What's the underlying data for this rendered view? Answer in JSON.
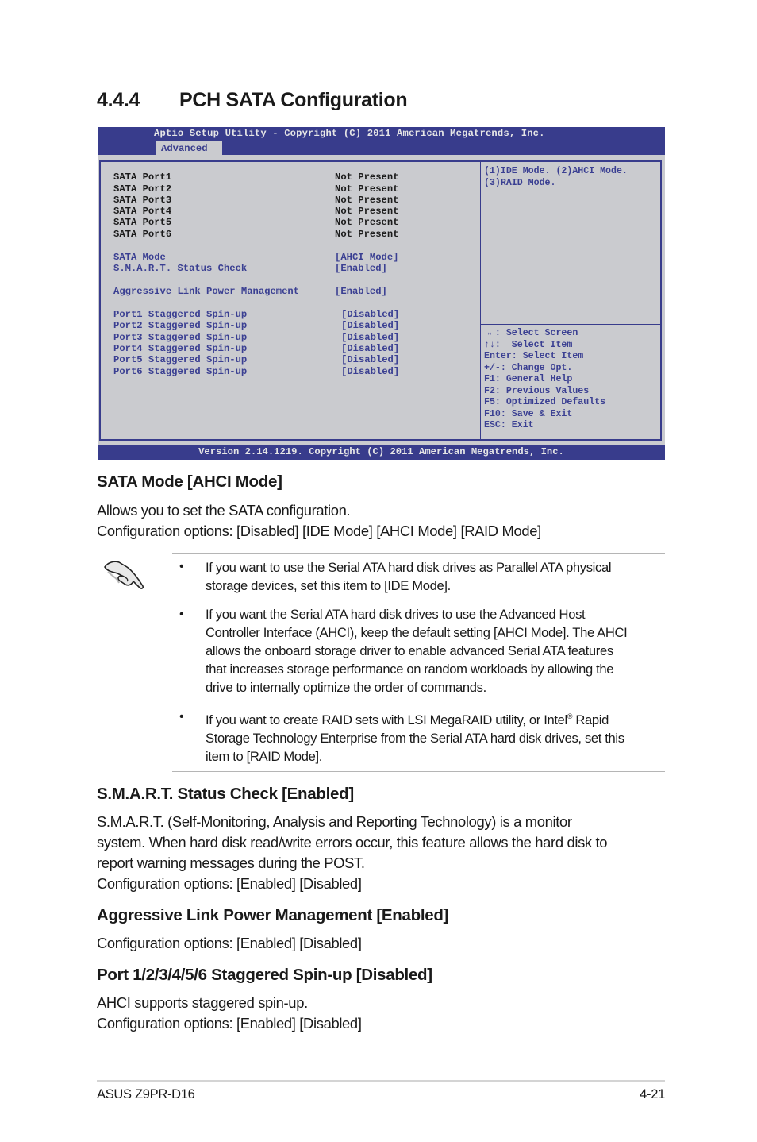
{
  "section": {
    "number": "4.4.4",
    "title": "PCH SATA Configuration"
  },
  "bios": {
    "header_title": "Aptio Setup Utility - Copyright (C) 2011 American Megatrends, Inc.",
    "active_tab": "Advanced",
    "ports": [
      {
        "label": "SATA Port1",
        "value": "Not Present"
      },
      {
        "label": "SATA Port2",
        "value": "Not Present"
      },
      {
        "label": "SATA Port3",
        "value": "Not Present"
      },
      {
        "label": "SATA Port4",
        "value": "Not Present"
      },
      {
        "label": "SATA Port5",
        "value": "Not Present"
      },
      {
        "label": "SATA Port6",
        "value": "Not Present"
      }
    ],
    "settings": [
      {
        "label": "SATA Mode",
        "value": "[AHCI Mode]"
      },
      {
        "label": "S.M.A.R.T. Status Check",
        "value": "[Enabled]"
      }
    ],
    "alpm": {
      "label": "Aggressive Link Power Management",
      "value": "[Enabled]"
    },
    "staggered": [
      {
        "label": "Port1 Staggered Spin-up",
        "value": "[Disabled]"
      },
      {
        "label": "Port2 Staggered Spin-up",
        "value": "[Disabled]"
      },
      {
        "label": "Port3 Staggered Spin-up",
        "value": "[Disabled]"
      },
      {
        "label": "Port4 Staggered Spin-up",
        "value": "[Disabled]"
      },
      {
        "label": "Port5 Staggered Spin-up",
        "value": "[Disabled]"
      },
      {
        "label": "Port6 Staggered Spin-up",
        "value": "[Disabled]"
      }
    ],
    "help_text": [
      "(1)IDE Mode. (2)AHCI Mode.",
      "(3)RAID Mode."
    ],
    "key_legend": [
      "→←: Select Screen",
      "↑↓:  Select Item",
      "Enter: Select Item",
      "+/-: Change Opt.",
      "F1: General Help",
      "F2: Previous Values",
      "F5: Optimized Defaults",
      "F10: Save & Exit",
      "ESC: Exit"
    ],
    "footer": "Version 2.14.1219. Copyright (C) 2011 American Megatrends, Inc.",
    "colors": {
      "bar": "#383c8c",
      "body": "#cacbcf",
      "selectable_text": "#3a3f92"
    }
  },
  "sata_mode": {
    "heading": "SATA Mode [AHCI Mode]",
    "lines": [
      "Allows you to set the SATA configuration.",
      "Configuration options: [Disabled] [IDE Mode] [AHCI Mode] [RAID Mode]"
    ]
  },
  "note": {
    "icon": "pointing-hand-icon",
    "bullets": [
      [
        "If you want to use the Serial ATA hard disk drives as Parallel ATA physical",
        "storage devices, set this item to [IDE Mode]."
      ],
      [
        "If you want the Serial ATA hard disk drives to use the Advanced Host",
        "Controller Interface (AHCI), keep the default setting [AHCI Mode]. The AHCI",
        "allows the onboard storage driver to enable advanced Serial ATA features",
        "that increases storage performance on random workloads by allowing the",
        "drive to internally optimize the order of commands."
      ],
      [
        "If you want to create RAID sets with LSI MegaRAID utility, or Intel",
        "Storage Technology Enterprise from the Serial ATA hard disk drives, set this",
        "item to [RAID Mode]."
      ]
    ],
    "bullet3_line1_suffix": " Rapid",
    "registered_mark": "®",
    "bullet_char": "•"
  },
  "smart": {
    "heading": "S.M.A.R.T. Status Check [Enabled]",
    "lines": [
      "S.M.A.R.T. (Self-Monitoring, Analysis and Reporting Technology) is a monitor",
      "system. When hard disk read/write errors occur, this feature allows the hard disk to",
      "report warning messages during the POST.",
      "Configuration options: [Enabled] [Disabled]"
    ]
  },
  "alpm_doc": {
    "heading": "Aggressive Link Power Management [Enabled]",
    "lines": [
      "Configuration options: [Enabled] [Disabled]"
    ]
  },
  "spinup_doc": {
    "heading": "Port 1/2/3/4/5/6 Staggered Spin-up [Disabled]",
    "lines": [
      "AHCI supports staggered spin-up.",
      "Configuration options: [Enabled] [Disabled]"
    ]
  },
  "page_footer": {
    "model": "ASUS Z9PR-D16",
    "page": "4-21"
  }
}
